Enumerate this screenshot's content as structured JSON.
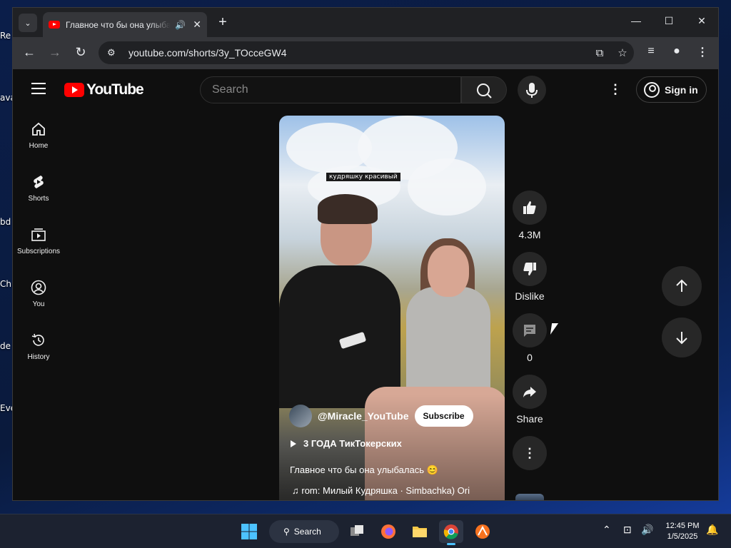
{
  "desktop": {
    "fragments": [
      "Re",
      "ava",
      "bd",
      "Ch",
      "de",
      "Eve"
    ]
  },
  "browser": {
    "tab": {
      "title": "Главное что бы она улыбалась"
    },
    "url": "youtube.com/shorts/3y_TOcceGW4"
  },
  "youtube": {
    "logo_text": "YouTube",
    "search_placeholder": "Search",
    "sign_in": "Sign in",
    "guide": [
      {
        "label": "Home"
      },
      {
        "label": "Shorts"
      },
      {
        "label": "Subscriptions"
      },
      {
        "label": "You"
      },
      {
        "label": "History"
      }
    ],
    "short": {
      "scene_caption": "кудряшку красивый",
      "channel": "@Miracle_YouTube",
      "subscribe": "Subscribe",
      "playlist": "3 ГОДА ТикТокерских",
      "title": "Главное что бы она улыбалась 😊",
      "sound": "rom: Милый Кудряшка · Simbachka)   Ori"
    },
    "actions": {
      "likes": "4.3M",
      "dislike": "Dislike",
      "comments": "0",
      "share": "Share"
    }
  },
  "taskbar": {
    "search_label": "Search",
    "time": "12:45 PM",
    "date": "1/5/2025"
  },
  "colors": {
    "youtube_red": "#ff0000",
    "page_bg": "#0f0f0f",
    "button_bg": "#272727"
  }
}
